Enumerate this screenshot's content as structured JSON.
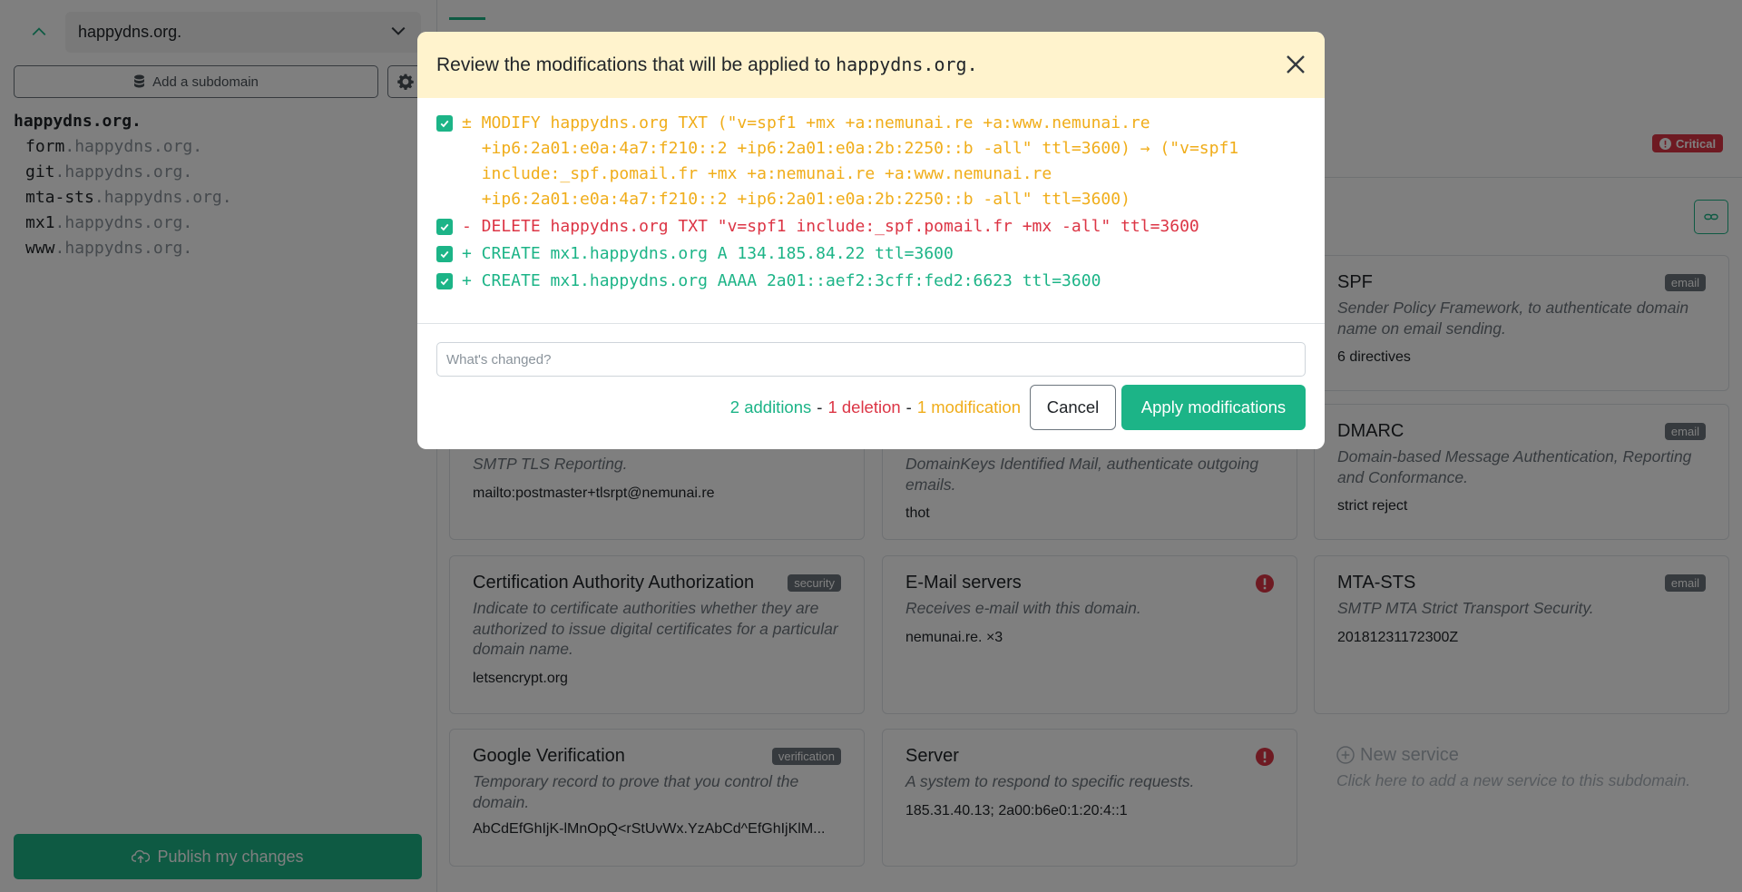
{
  "sidebar": {
    "domain": "happydns.org.",
    "add_subdomain_label": "Add a subdomain",
    "tree_root": "happydns.org.",
    "subdomains": [
      {
        "name": "form",
        "suffix": ".happydns.org."
      },
      {
        "name": "git",
        "suffix": ".happydns.org."
      },
      {
        "name": "mta-sts",
        "suffix": ".happydns.org."
      },
      {
        "name": "mx1",
        "suffix": ".happydns.org."
      },
      {
        "name": "www",
        "suffix": ".happydns.org."
      }
    ],
    "publish_label": "Publish my changes"
  },
  "main": {
    "critical_label": "Critical",
    "cards": [
      {
        "title": "SPF",
        "badge": "email",
        "desc": "Sender Policy Framework, to authenticate domain name on email sending.",
        "value": "6 directives"
      },
      {
        "title": "",
        "badge": "",
        "desc": "SMTP TLS Reporting.",
        "value": "mailto:postmaster+tlsrpt@nemunai.re"
      },
      {
        "title": "",
        "badge": "",
        "desc": "DomainKeys Identified Mail, authenticate outgoing emails.",
        "value": "thot"
      },
      {
        "title": "DMARC",
        "badge": "email",
        "desc": "Domain-based Message Authentication, Reporting and Conformance.",
        "value": "strict reject"
      },
      {
        "title": "Certification Authority Authorization",
        "badge": "security",
        "desc": "Indicate to certificate authorities whether they are authorized to issue digital certificates for a particular domain name.",
        "value": "letsencrypt.org"
      },
      {
        "title": "E-Mail servers",
        "badge": "",
        "desc": "Receives e-mail with this domain.",
        "value": "nemunai.re. ×3"
      },
      {
        "title": "MTA-STS",
        "badge": "email",
        "desc": "SMTP MTA Strict Transport Security.",
        "value": "20181231172300Z"
      },
      {
        "title": "Google Verification",
        "badge": "verification",
        "desc": "Temporary record to prove that you control the domain.",
        "value": "AbCdEfGhIjK-lMnOpQ<rStUvWx.YzAbCd^EfGhIjKlM..."
      },
      {
        "title": "Server",
        "badge": "",
        "desc": "A system to respond to specific requests.",
        "value": "185.31.40.13; 2a00:b6e0:1:20:4::1"
      },
      {
        "title": "New service",
        "badge": "",
        "desc": "Click here to add a new service to this subdomain.",
        "value": ""
      }
    ]
  },
  "modal": {
    "title": "Review the modifications that will be applied to",
    "domain": "happydns.org.",
    "changes": [
      {
        "kind": "modify",
        "text": "± MODIFY happydns.org TXT (\"v=spf1 +mx +a:nemunai.re +a:www.nemunai.re\n  +ip6:2a01:e0a:4a7:f210::2 +ip6:2a01:e0a:2b:2250::b -all\" ttl=3600) → (\"v=spf1\n  include:_spf.pomail.fr +mx +a:nemunai.re +a:www.nemunai.re\n  +ip6:2a01:e0a:4a7:f210::2 +ip6:2a01:e0a:2b:2250::b -all\" ttl=3600)"
      },
      {
        "kind": "delete",
        "text": "- DELETE happydns.org TXT \"v=spf1 include:_spf.pomail.fr +mx -all\" ttl=3600"
      },
      {
        "kind": "create",
        "text": "+ CREATE mx1.happydns.org A 134.185.84.22 ttl=3600"
      },
      {
        "kind": "create",
        "text": "+ CREATE mx1.happydns.org AAAA 2a01::aef2:3cff:fed2:6623 ttl=3600"
      }
    ],
    "message_placeholder": "What's changed?",
    "summary": {
      "additions": "2 additions",
      "deletions": "1 deletion",
      "modifications": "1 modification",
      "separator": "-"
    },
    "cancel_label": "Cancel",
    "apply_label": "Apply modifications"
  },
  "colors": {
    "accent": "#1cb487",
    "danger": "#dc3545",
    "warning": "#f0ad1a",
    "header_bg": "#fff3cd"
  }
}
